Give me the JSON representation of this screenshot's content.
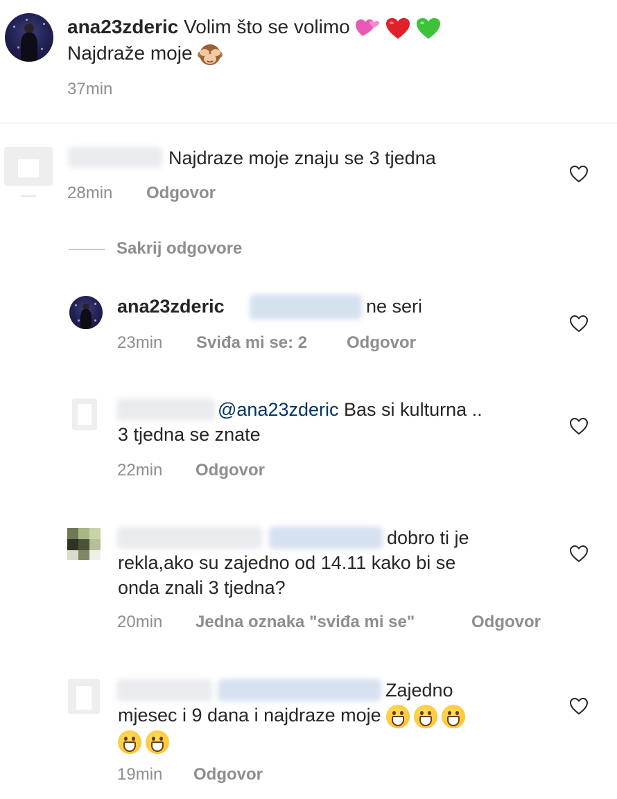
{
  "caption": {
    "username": "ana23zderic",
    "line1": "Volim što se volimo",
    "line2": "Najdraže moje",
    "time": "37min"
  },
  "comments": [
    {
      "text": "Najdraze moje znaju se 3 tjedna",
      "time": "28min",
      "reply_label": "Odgovor"
    }
  ],
  "hide_replies_label": "Sakrij odgovore",
  "replies": [
    {
      "username": "ana23zderic",
      "text": "ne seri",
      "time": "23min",
      "likes": "Sviđa mi se: 2",
      "reply_label": "Odgovor"
    },
    {
      "mention": "@ana23zderic",
      "text_line1": "Bas si kulturna ..",
      "text_line2": "3 tjedna se znate",
      "time": "22min",
      "reply_label": "Odgovor"
    },
    {
      "text_line1": "dobro ti je",
      "text_line2": "rekla,ako su zajedno od 14.11 kako bi se",
      "text_line3": "onda znali 3 tjedna?",
      "time": "20min",
      "likes": "Jedna oznaka \"sviđa mi se\"",
      "reply_label": "Odgovor"
    },
    {
      "text_line1": "Zajedno",
      "text_line2": "mjesec i 9 dana i najdraze moje",
      "time": "19min",
      "reply_label": "Odgovor"
    }
  ],
  "icons": {
    "like": "heart-outline-icon",
    "caption_emojis": [
      "two-hearts-icon",
      "red-heart-icon",
      "green-heart-icon",
      "see-no-evil-monkey-icon"
    ],
    "grin_emoji": "grinning-face-icon"
  }
}
